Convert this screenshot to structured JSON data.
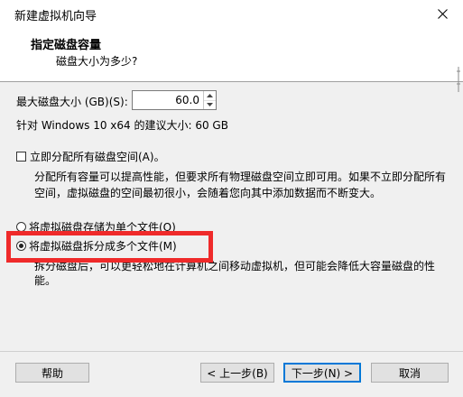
{
  "window": {
    "title": "新建虚拟机向导"
  },
  "header": {
    "title": "指定磁盘容量",
    "subtitle": "磁盘大小为多少?"
  },
  "max_disk": {
    "label": "最大磁盘大小 (GB)(S):",
    "value": "60.0"
  },
  "recommend_text": "针对 Windows 10 x64 的建议大小: 60 GB",
  "allocate": {
    "checkbox_label": "立即分配所有磁盘空间(A)。",
    "checked": false,
    "description": "分配所有容量可以提高性能，但要求所有物理磁盘空间立即可用。如果不立即分配所有空间，虚拟磁盘的空间最初很小，会随着您向其中添加数据而不断变大。"
  },
  "storage_options": {
    "single": {
      "label": "将虚拟磁盘存储为单个文件(O)",
      "selected": false
    },
    "multiple": {
      "label": "将虚拟磁盘拆分成多个文件(M)",
      "selected": true,
      "description": "拆分磁盘后，可以更轻松地在计算机之间移动虚拟机，但可能会降低大容量磁盘的性能。"
    }
  },
  "buttons": {
    "help": "帮助",
    "back": "< 上一步(B)",
    "next": "下一步(N) >",
    "cancel": "取消"
  },
  "colors": {
    "highlight": "#ef2a2a",
    "primary_border": "#0078d7",
    "dialog_bg": "#f0f0f0"
  }
}
